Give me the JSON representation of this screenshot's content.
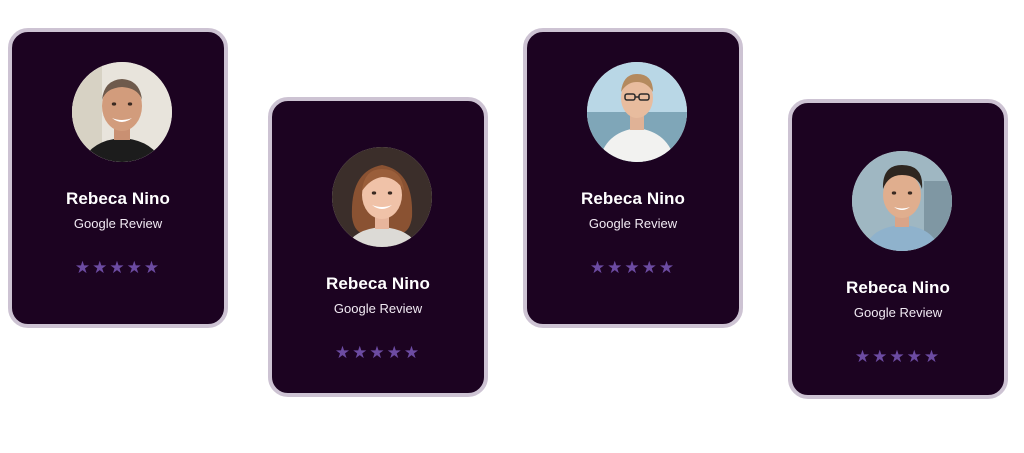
{
  "colors": {
    "card_background": "#1c0321",
    "card_border": "#cdc3d3",
    "star": "#6c4ba2",
    "name_text": "#ffffff"
  },
  "reviews": [
    {
      "name": "Rebeca Nino",
      "source": "Google Review",
      "stars": "★★★★★",
      "rating": 5,
      "avatar": "man-bald-smiling-photo"
    },
    {
      "name": "Rebeca Nino",
      "source": "Google Review",
      "stars": "★★★★★",
      "rating": 5,
      "avatar": "woman-brown-hair-photo"
    },
    {
      "name": "Rebeca Nino",
      "source": "Google Review",
      "stars": "★★★★★",
      "rating": 5,
      "avatar": "young-man-glasses-photo"
    },
    {
      "name": "Rebeca Nino",
      "source": "Google Review",
      "stars": "★★★★★",
      "rating": 5,
      "avatar": "young-man-dark-hair-photo"
    }
  ]
}
